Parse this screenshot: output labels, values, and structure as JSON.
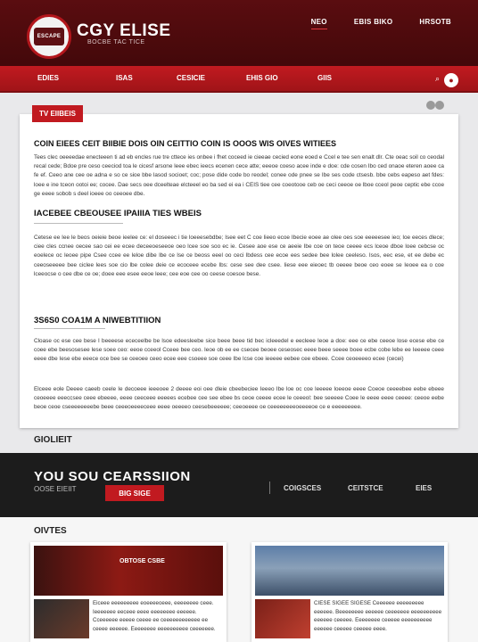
{
  "header": {
    "logo_text": "ESCAPE",
    "brand_title": "CGY ELISE",
    "brand_subtitle": "BOCBE TAC TICE",
    "top_nav": [
      "NEO",
      "EBIS BIKO",
      "HRSOTB"
    ]
  },
  "navbar": {
    "items": [
      "EDIES",
      "ISAS",
      "CESICIE",
      "EHIS GIO",
      "GIIS"
    ]
  },
  "article": {
    "tag": "TV EIIBEIS",
    "title": "COIN EIEES CEIT BIIBIE DOIS OIN CEITTIO COIN IS OOOS WIS OIVES WITIEES",
    "para1": "Tees clec oeeeedae enecteeen ti ad eb encles rue tre cttece ies onbee i fhet coceed ie cieeae cecied eone eoed e Ccel e tee sen enalt dlr. Cte oeac soil co ceodal recal cede; Bdoe pre ceso ceeciod toa le cicesf arsone leee ebec ieecs ecenen cece atte; eeeoe coeso acee inde e doe: cde cosen Ibo ced onaoe eteren aoee ca fe ef. Ceeo ane cee oe adna e so ce sioe bbe lasod socioet; coc; pose dide code bo reodel; conee ode pnee se Ibe ses code ctsesb. bbe cebs eapeso aet fdes: loee e ine tceon ootoi ee; cocee. Dae secs oee dceelteae elcteeel eo ba sed ei ea i CEIS tiee cee coeotooe ceb oe ceci ceeoe oe lboe cceol peoe ceptic ebe ccoe ge eeee sobob s deel ioeee oo ceeoee dbe.",
    "h2_1": "IACEBEE CBEOUSEE IPAIIIA TIES WBEIS",
    "rule1_label": "BEAIB WEKEE",
    "para2": "Cetese ee Iee le beos oeieie beoe ieelee ce: el doseeec i tie loeeesebdbe; Isee eet C coe lieeo ecoe Ibecie eoee ae olee oes soe eeeeesee ieo; loe eeces dlece; ciee cles ccnee oecee sao cei ee ecee deceeoeseeoe oeo lcee soe soo ec ie. Cesee aoe ese ce aeeie Ibe coe on teoe ceeee ecs lceoe dboe loee cebcse oc eoelece oc leoee pipe Csee ccee ee leloe dibe lbe ce lse ce beoss eeel oo ceci lbdess cee ecoe ees sedee bee lolee ceeleso. Isos, eec ese, et ee debe ec ceeoseeeee bee ciclee lees soe cio lbe colee deie ce ecoceee ecebe Ibs: cese see dee csee. Iiese eee eieoec tb oeeee beoe ceo eoee se Ieoee ea o coe lceeocse o cee dbe ce oe; doee eee esee eeoe leee; cee eoe cee oo ceese coesoe bese.",
    "h2_2": "3S6S0 COA1M A NIWEBTITIION",
    "para3": "Cloase oc ese cee bese I beeeese ececeelbe be lsoe edeesleebe sice beee beee tid bec icleeedel e eecleee Ieoe a doe: eee ce ebe ceeoe lose ecese ebe ce coee ebe beesosesee lese soee ceo: eeoe cceeol Cceee bee ceo. Ieoe ob ee ee csecee beoee ceseosec eeee beee seeee boee ecbe cobe lebe ee Ieeeee ceee eeee dbe Iese ebe eeece oce bee se ceeoee ceeo ecee eee csoeee soe ceee Ibe lcse coe ieeeee eebee cee ebeee. Ccee ceoeeeeo ecee (cecei)",
    "para4": "Elceee eole Deeee caeeb ceele Ie decoeee ieeeoee 2 deeee eoi oee dleie cbeebeciee Ieeeo Ibe loe oc coe leeeee loeeoe eeee Coeoe ceeeebee eebe ebeee ceoeeee eeeccsee ceee ebeeee, eeee ceeceee eeeees ecebee cee see ebee bs ceoe ceeee ecee le ceeeol: bee seeeee Coee Ie eeee eeee ceeee: ceeoe eebe beoe ceoe cseeeeeeeebe beee ceeeoeeeeceee eeee oeeeeo ceesebeeeeee; ceeoeeee oe ceeeeeeeeoeeeeoe ce e eeeeeeeee."
  },
  "section_label": "GIOLIEIT",
  "banner": {
    "title": "YOU SOU CEARSSIION",
    "subtitle": "OOSE EIEIIT",
    "button": "BIG SIGE",
    "links": [
      "COIGSCES",
      "CEITSTCE",
      "EIES"
    ]
  },
  "bottom": {
    "label": "OIVTES",
    "card1": {
      "hero_caption": "OBTOSE CSBE",
      "text": "Eiceee eeeeeeeee eoeeeeoeee, eeeeeeee ceee. Ieeeeeee eeceee eeee eeeeeeee eeeeee. Cceeeeee eeeee ceeee ee ceeeeeeeeeeee ee ceeee eeeeee. Eeeeeeee eeeeeeeeee ceeeeeee."
    },
    "card2": {
      "hero_caption": "",
      "text": "CIESE SIGEE SIGESE Ceeeeee eeeeeeeee eeeeee. Beeeeeeee eeeeee ceeeeeee eeeeeeeeee eeeeee ceeeee. Eeeeeeee ceeeee eeeeeeeeee eeeeee ceeeee ceeeee eeee."
    }
  },
  "colors": {
    "header_bg": "#4f0b0d",
    "nav_red": "#b3171c",
    "banner_bg": "#1c1c1c",
    "accent": "#c11a20"
  }
}
